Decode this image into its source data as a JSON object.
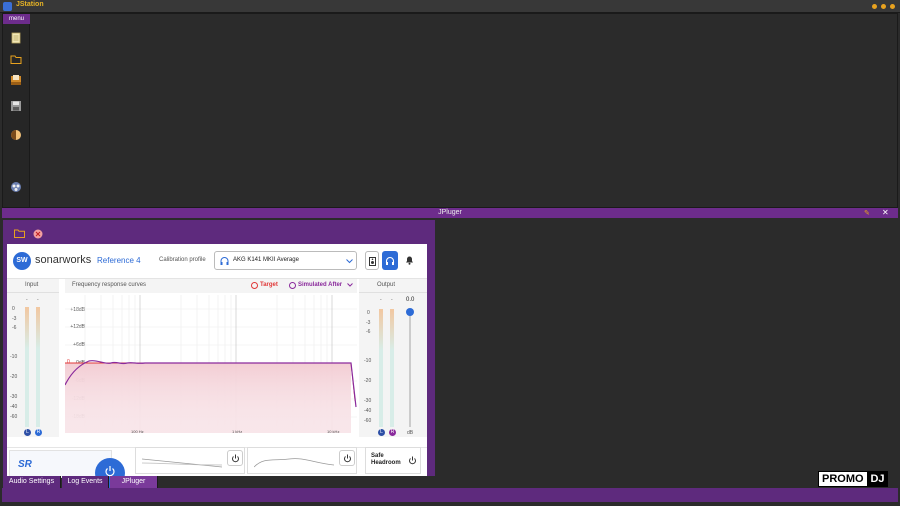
{
  "app": {
    "title": "JStation"
  },
  "sidebar": {
    "menu_label": "menu",
    "icons": [
      "notepad-icon",
      "folder-icon",
      "box-icon",
      "save-icon",
      "half-circle-icon",
      "palette-icon"
    ]
  },
  "jpluger": {
    "title": "JPluger"
  },
  "plugin": {
    "brand": "sonarworks",
    "product": "Reference 4",
    "calibration_label": "Calibration profile",
    "calibration_value": "AKG K141 MKII Average",
    "input_label": "Input",
    "output_label": "Output",
    "freq_title": "Frequency response curves",
    "target_label": "Target",
    "simulated_label": "Simulated After",
    "output_value": "0.0",
    "db_unit": "dB",
    "meter_dash": "-",
    "input_scale": [
      "0",
      "-3",
      "-6",
      "-10",
      "-20",
      "-30",
      "-40",
      "-60"
    ],
    "output_scale": [
      "0",
      "-3",
      "-6",
      "-10",
      "-20",
      "-30",
      "-40",
      "-60"
    ],
    "freq_db_scale": [
      "+18dB",
      "+12dB",
      "+6dB",
      "0dB",
      "-6dB",
      "-12dB",
      "-18dB"
    ],
    "freq_marker": "0",
    "freq_hz_scale": [
      "100 Hz",
      "1 kHz",
      "10 kHz"
    ],
    "lr": {
      "l": "L",
      "r": "R"
    },
    "sr_label": "SR",
    "safe_headroom": "Safe Headroom",
    "colors": {
      "accent": "#2d6bd6",
      "target": "#e03838",
      "simulated": "#8a2a9c",
      "purple_frame": "#6d2c8c"
    }
  },
  "tabs": [
    "Audio Settings",
    "Log Events",
    "JPluger"
  ],
  "watermark": {
    "part1": "PROMO",
    "part2": "DJ"
  }
}
